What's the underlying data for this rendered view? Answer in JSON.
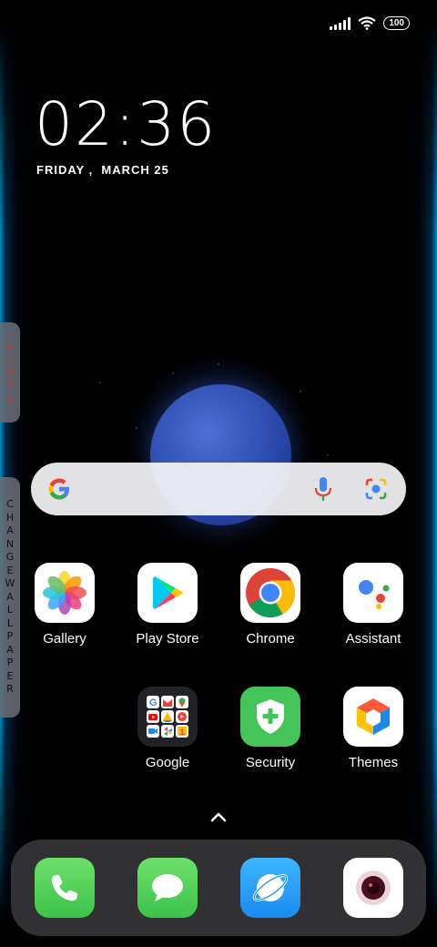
{
  "status_bar": {
    "battery": "100",
    "icons": [
      "signal-icon",
      "wifi-icon",
      "battery-icon"
    ]
  },
  "clock": {
    "time": "02:36",
    "date": "FRIDAY ,  MARCH 25"
  },
  "side_tabs": {
    "close": "CLOSE",
    "change_wallpaper": "CHANGEWALLPAPER"
  },
  "search": {
    "icons": [
      "google-logo-icon",
      "mic-icon",
      "lens-icon"
    ]
  },
  "apps": [
    {
      "label": "Gallery",
      "icon": "gallery-icon"
    },
    {
      "label": "Play Store",
      "icon": "play-store-icon"
    },
    {
      "label": "Chrome",
      "icon": "chrome-icon"
    },
    {
      "label": "Assistant",
      "icon": "assistant-icon"
    },
    {
      "label": "Google",
      "icon": "google-folder-icon"
    },
    {
      "label": "Security",
      "icon": "security-icon"
    },
    {
      "label": "Themes",
      "icon": "themes-icon"
    }
  ],
  "dock": [
    "phone-icon",
    "messages-icon",
    "browser-icon",
    "camera-icon"
  ],
  "colors": {
    "accent_blue": "#1a73e8",
    "close_text": "#e23a3a",
    "dock_green": "#4cd964",
    "browser_blue": "#1ea0f5"
  }
}
